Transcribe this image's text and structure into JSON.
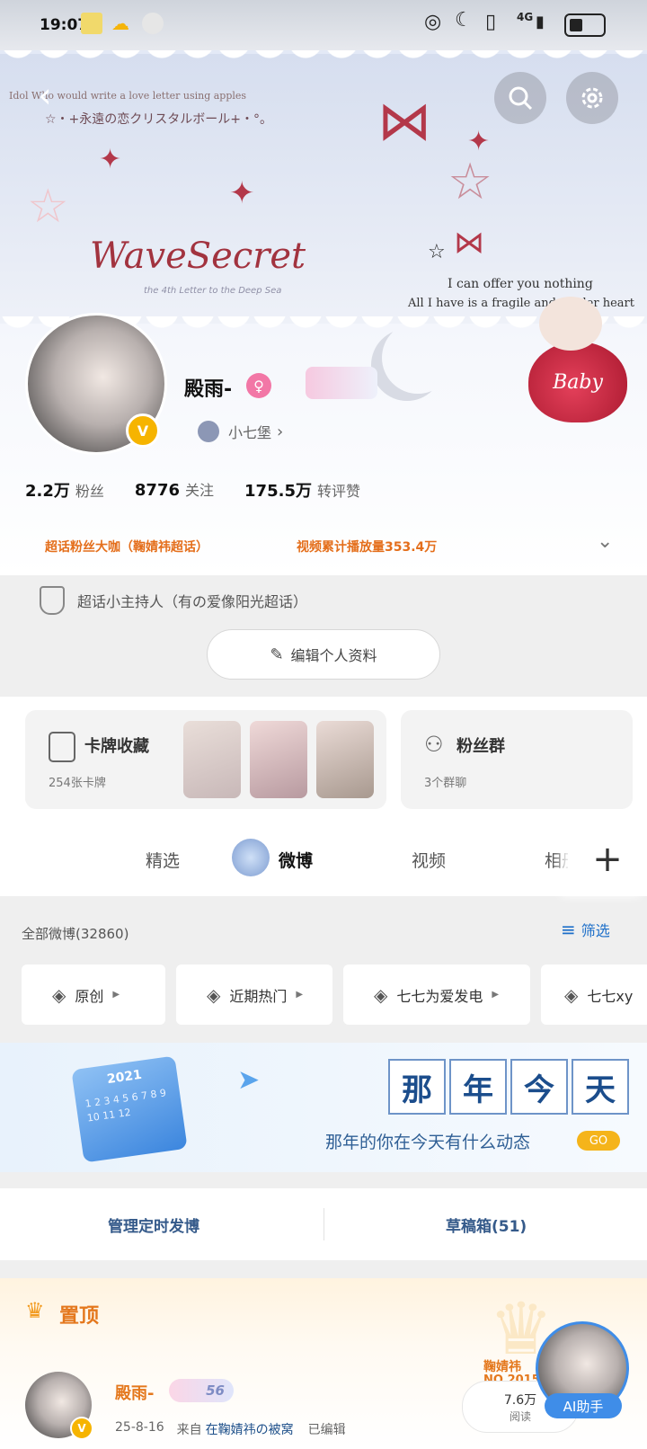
{
  "status": {
    "time": "19:07",
    "network": "4G"
  },
  "banner": {
    "line1": "Idol Who would write a love letter using apples",
    "line2": "☆・+永遠の恋クリスタルボール+・°。",
    "title": "WaveSecret",
    "subtitle": "the 4th Letter to the Deep Sea",
    "quote1": "I can offer you nothing",
    "quote2": "All I have is a fragile and tender heart",
    "badge_text": "Baby"
  },
  "profile": {
    "username": "殿雨-",
    "group_label": "小七堡",
    "stats": [
      {
        "num": "2.2万",
        "label": "粉丝"
      },
      {
        "num": "8776",
        "label": "关注"
      },
      {
        "num": "175.5万",
        "label": "转评赞"
      }
    ],
    "tag1": "超话粉丝大咖（鞠婧祎超话）",
    "tag2": "视频累计播放量353.4万",
    "host_line": "超话小主持人（有の爱像阳光超话）",
    "edit_label": "编辑个人资料"
  },
  "cards": {
    "cards_title": "卡牌收藏",
    "cards_sub": "254张卡牌",
    "fans_title": "粉丝群",
    "fans_sub": "3个群聊"
  },
  "tabs": [
    "精选",
    "微博",
    "视频",
    "相册"
  ],
  "filter": {
    "all_label": "全部微博(32860)",
    "filter_label": "筛选",
    "chips": [
      "原创",
      "近期热门",
      "七七为爱发电",
      "七七xy"
    ]
  },
  "memory": {
    "chars": [
      "那",
      "年",
      "今",
      "天"
    ],
    "text": "那年的你在今天有什么动态",
    "go": "GO",
    "cal_year": "2021",
    "cal_nums": "1 2 3 4 5 6 7 8 9 10 11 12"
  },
  "actions": {
    "schedule": "管理定时发博",
    "drafts": "草稿箱(51)"
  },
  "pinned": {
    "label": "置顶",
    "name": "殿雨-",
    "level": "56",
    "date": "25-8-16",
    "from_prefix": "来自",
    "from_source": "在鞠婧祎の被窝",
    "edited": "已编辑",
    "deco_name": "鞠婧祎",
    "deco_no": "NO.2015",
    "reads_num": "7.6万",
    "reads_label": "阅读",
    "ai_label": "AI助手"
  },
  "colors": {
    "accent_orange": "#e46e1b",
    "link_blue": "#1d6fc9",
    "tab_active": "#111111"
  }
}
